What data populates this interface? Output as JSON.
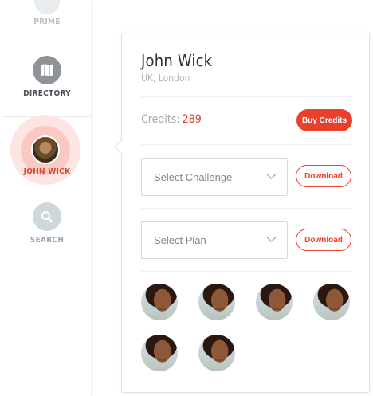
{
  "nav": {
    "items": [
      {
        "label": "PRIME",
        "icon": "prime-icon"
      },
      {
        "label": "DIRECTORY",
        "icon": "directory-map-icon"
      },
      {
        "label": "JOHN WICK",
        "icon": "avatar",
        "active": true
      },
      {
        "label": "SEARCH",
        "icon": "search-icon"
      }
    ]
  },
  "profile": {
    "name": "John Wick",
    "location": "UK, London",
    "credits_label": "Credits:",
    "credits_value": "289",
    "buy_label": "Buy Credits"
  },
  "challenge": {
    "placeholder": "Select Challenge",
    "download_label": "Download"
  },
  "plan": {
    "placeholder": "Select Plan",
    "download_label": "Download"
  },
  "photos": [
    {
      "name": "photo-1"
    },
    {
      "name": "photo-2"
    },
    {
      "name": "photo-3"
    },
    {
      "name": "photo-4"
    },
    {
      "name": "photo-5"
    },
    {
      "name": "photo-6"
    }
  ],
  "colors": {
    "accent": "#e8402d",
    "text_dark": "#2b3138",
    "text_muted": "#a4abb1"
  }
}
